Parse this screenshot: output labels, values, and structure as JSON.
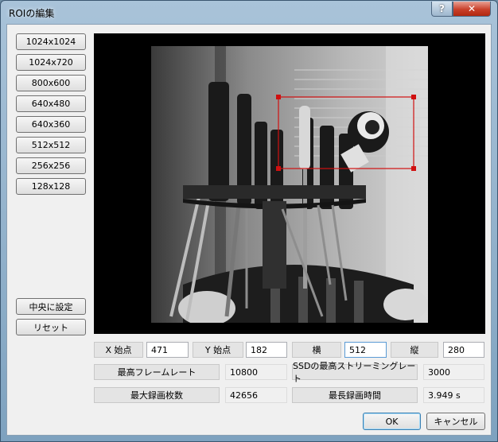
{
  "window": {
    "title": "ROIの編集",
    "help_label": "?",
    "close_label": "✕"
  },
  "presets": [
    "1024x1024",
    "1024x720",
    "800x600",
    "640x480",
    "640x360",
    "512x512",
    "256x256",
    "128x128"
  ],
  "left_actions": {
    "center_label": "中央に設定",
    "reset_label": "リセット"
  },
  "roi": {
    "x_label": "X 始点",
    "x_value": "471",
    "y_label": "Y 始点",
    "y_value": "182",
    "width_label": "横",
    "width_value": "512",
    "height_label": "縦",
    "height_value": "280"
  },
  "stats": {
    "max_frame_rate_label": "最高フレームレート",
    "max_frame_rate": "10800",
    "ssd_stream_rate_label": "SSDの最高ストリーミングレート",
    "ssd_stream_rate": "3000",
    "max_frames_label": "最大録画枚数",
    "max_frames": "42656",
    "max_time_label": "最長録画時間",
    "max_time": "3.949 s"
  },
  "footer": {
    "ok_label": "OK",
    "cancel_label": "キャンセル"
  },
  "colors": {
    "roi_rect": "#d01010",
    "preview_bg": "#000000",
    "title_accent": "#7ea2bf"
  }
}
